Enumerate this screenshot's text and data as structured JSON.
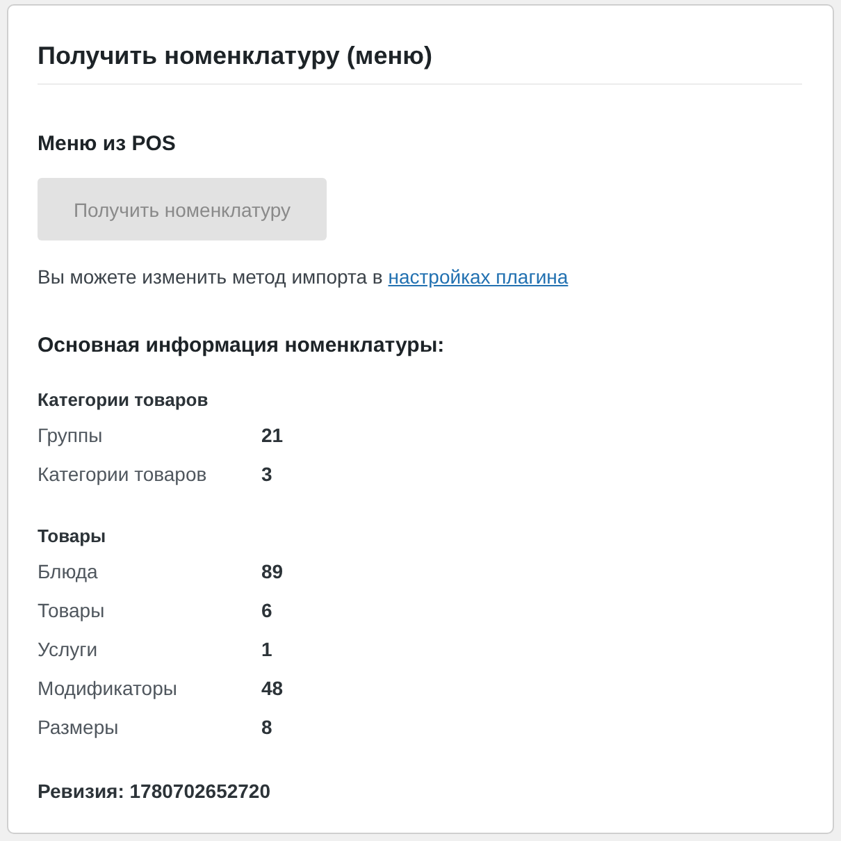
{
  "panel": {
    "title": "Получить номенклатуру (меню)"
  },
  "pos_section": {
    "heading": "Меню из POS",
    "button": {
      "label": "Получить номенклатуру",
      "disabled": true
    },
    "note": {
      "text": "Вы можете изменить метод импорта в ",
      "link": "настройках плагина"
    }
  },
  "info": {
    "heading": "Основная информация номенклатуры:",
    "groups": [
      {
        "title": "Категории товаров",
        "rows": [
          {
            "label": "Группы",
            "value": "21"
          },
          {
            "label": "Категории товаров",
            "value": "3"
          }
        ]
      },
      {
        "title": "Товары",
        "rows": [
          {
            "label": "Блюда",
            "value": "89"
          },
          {
            "label": "Товары",
            "value": "6"
          },
          {
            "label": "Услуги",
            "value": "1"
          },
          {
            "label": "Модификаторы",
            "value": "48"
          },
          {
            "label": "Размеры",
            "value": "8"
          }
        ]
      }
    ],
    "revision": "Ревизия: 1780702652720"
  }
}
